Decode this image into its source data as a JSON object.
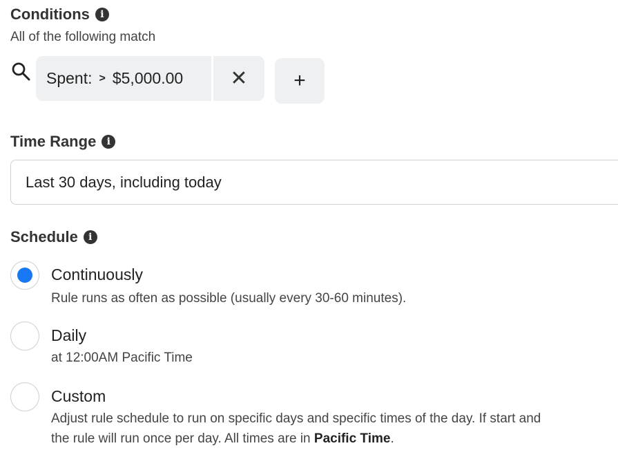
{
  "conditions": {
    "title": "Conditions",
    "subtitle": "All of the following match",
    "chip": {
      "field": "Spent:",
      "operator": ">",
      "value": "$5,000.00"
    }
  },
  "time_range": {
    "title": "Time Range",
    "value": "Last 30 days, including today"
  },
  "schedule": {
    "title": "Schedule",
    "options": [
      {
        "label": "Continuously",
        "desc": "Rule runs as often as possible (usually every 30-60 minutes).",
        "selected": true
      },
      {
        "label": "Daily",
        "desc": "at 12:00AM Pacific Time",
        "selected": false
      },
      {
        "label": "Custom",
        "desc1": "Adjust rule schedule to run on specific days and specific times of the day. If start and",
        "desc2": "the rule will run once per day. All times are in ",
        "desc_bold": "Pacific Time",
        "desc_end": ".",
        "selected": false
      }
    ]
  },
  "colors": {
    "accent": "#1877f2",
    "chip_bg": "#eef0f2"
  }
}
